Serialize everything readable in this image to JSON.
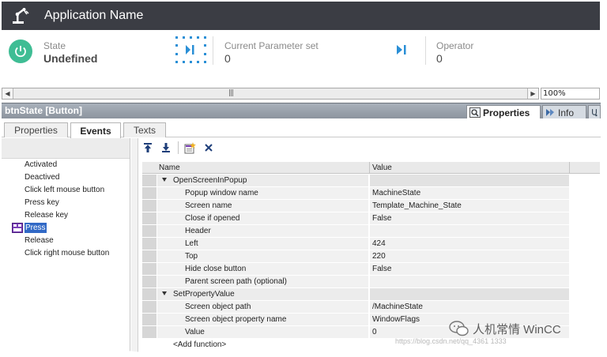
{
  "app": {
    "title": "Application Name"
  },
  "status": {
    "state_label": "State",
    "state_value": "Undefined",
    "param_label": "Current Parameter set",
    "param_value": "0",
    "operator_label": "Operator",
    "operator_value": "0"
  },
  "canvas": {
    "zoom": "100%"
  },
  "inspector": {
    "title": "btnState [Button]",
    "tabs": [
      {
        "label": "Properties",
        "active": true
      },
      {
        "label": "Info",
        "active": false
      }
    ]
  },
  "subtabs": [
    {
      "label": "Properties"
    },
    {
      "label": "Events",
      "active": true
    },
    {
      "label": "Texts"
    }
  ],
  "events": [
    {
      "label": "Activated"
    },
    {
      "label": "Deactived"
    },
    {
      "label": "Click left mouse button"
    },
    {
      "label": "Press key"
    },
    {
      "label": "Release key"
    },
    {
      "label": "Press",
      "selected": true
    },
    {
      "label": "Release"
    },
    {
      "label": "Click right mouse button"
    }
  ],
  "grid": {
    "col_name": "Name",
    "col_value": "Value",
    "rows": [
      {
        "type": "group",
        "name": "OpenScreenInPopup",
        "value": ""
      },
      {
        "type": "param",
        "name": "Popup window name",
        "value": "MachineState"
      },
      {
        "type": "param",
        "name": "Screen name",
        "value": "Template_Machine_State"
      },
      {
        "type": "param",
        "name": "Close if opened",
        "value": "False"
      },
      {
        "type": "param",
        "name": "Header",
        "value": ""
      },
      {
        "type": "param",
        "name": "Left",
        "value": "424"
      },
      {
        "type": "param",
        "name": "Top",
        "value": "220"
      },
      {
        "type": "param",
        "name": "Hide close button",
        "value": "False"
      },
      {
        "type": "param",
        "name": "Parent screen path (optional)",
        "value": ""
      },
      {
        "type": "group",
        "name": "SetPropertyValue",
        "value": ""
      },
      {
        "type": "param",
        "name": "Screen object path",
        "value": "/MachineState"
      },
      {
        "type": "param",
        "name": "Screen object property name",
        "value": "WindowFlags"
      },
      {
        "type": "param",
        "name": "Value",
        "value": "0"
      },
      {
        "type": "add",
        "name": "<Add function>",
        "value": ""
      }
    ]
  },
  "watermark": {
    "text": "人机常情 WinCC",
    "url": "https://blog.csdn.net/qq_4361 1333"
  },
  "colors": {
    "app_bar": "#3b3d44",
    "state_green": "#3fbd94",
    "accent_blue": "#2a8fd6",
    "selection": "#3169c6"
  },
  "icons": {
    "app": "robot-arm-icon",
    "state": "power-icon",
    "param": "skip-to-end-frame-icon",
    "operator": "skip-to-end-icon",
    "event_selected": "script-icon",
    "toolbar": [
      "move-up-icon",
      "move-down-icon",
      "insert-function-icon",
      "delete-icon"
    ]
  }
}
